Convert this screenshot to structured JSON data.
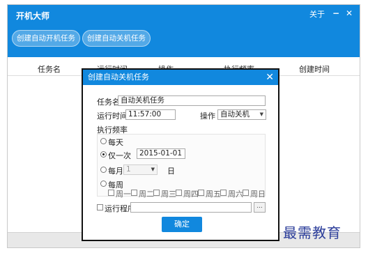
{
  "app": {
    "title": "开机大师",
    "about": "关于",
    "minimize": "−",
    "close": "✕"
  },
  "toolbar": {
    "create_startup_task": "创建自动开机任务",
    "create_shutdown_task": "创建自动关机任务"
  },
  "table": {
    "columns": [
      "任务名",
      "运行时间",
      "操作",
      "执行频率",
      "创建时间"
    ]
  },
  "dialog": {
    "title": "创建自动关机任务",
    "close": "✕",
    "task_name_label": "任务名",
    "task_name_value": "自动关机任务",
    "run_time_label": "运行时间",
    "run_time_value": "11:57:00",
    "operation_label": "操作",
    "operation_value": "自动关机",
    "frequency_label": "执行频率",
    "frequency": {
      "daily": "每天",
      "once": "仅一次",
      "once_date": "2015-01-01",
      "monthly": "每月",
      "monthly_value": "1",
      "day_unit": "日",
      "weekly": "每周",
      "weekdays": [
        "周一",
        "周二",
        "周三",
        "周四",
        "周五",
        "周六",
        "周日"
      ],
      "selected": "once"
    },
    "run_program_label": "运行程序",
    "run_program_value": "",
    "browse": "...",
    "ok": "确定"
  },
  "watermark": "最需教育"
}
